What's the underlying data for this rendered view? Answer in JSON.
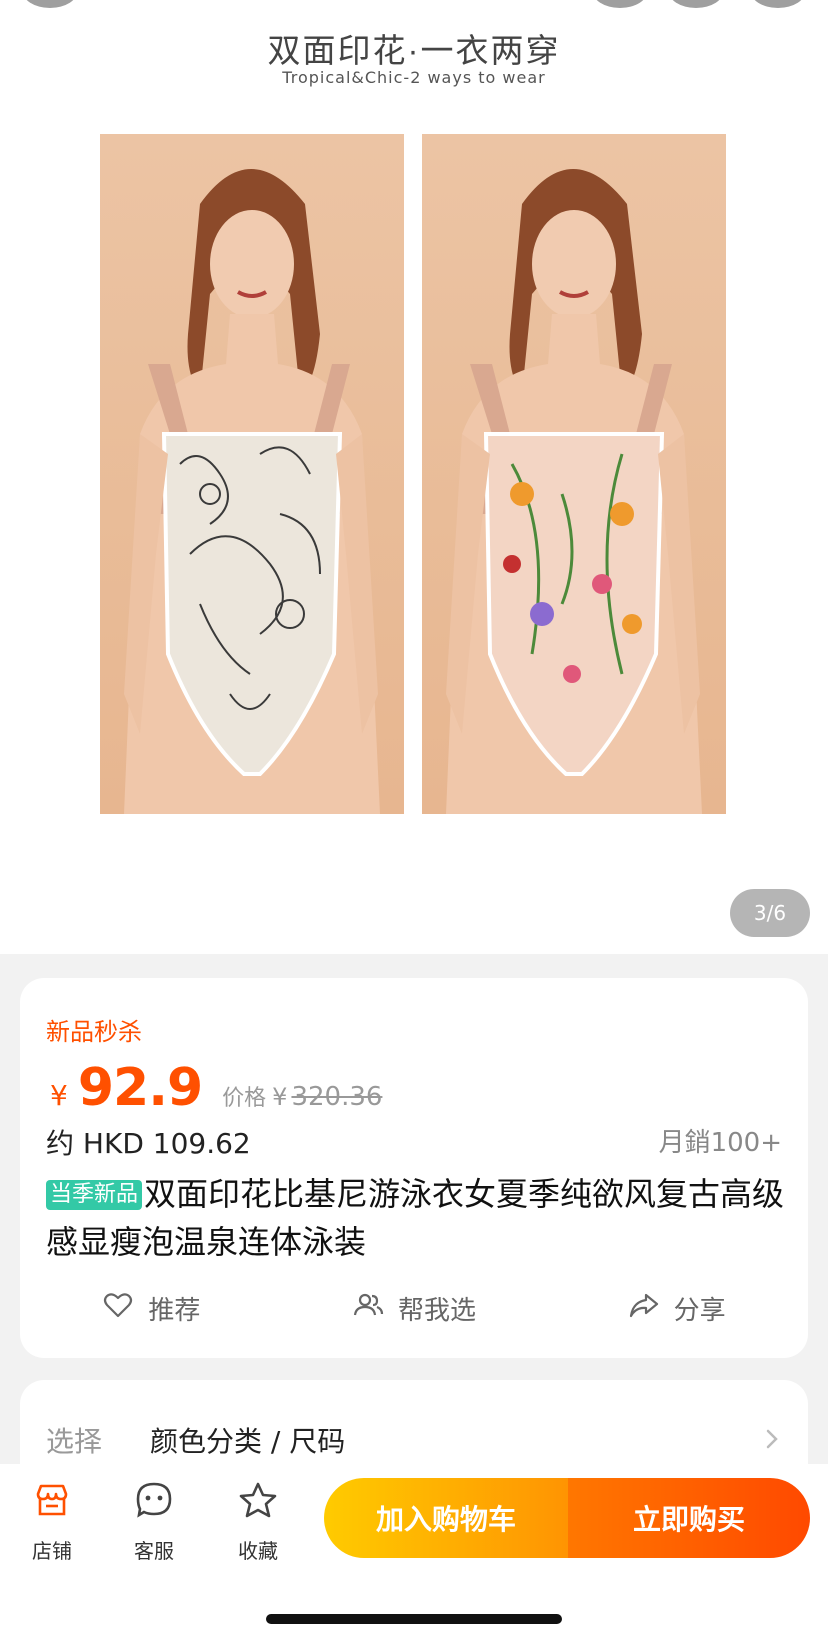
{
  "hero": {
    "heading": "双面印花·一衣两穿",
    "subheading": "Tropical&Chic-2 ways to wear",
    "page_indicator": "3/6",
    "current_image": 3,
    "total_images": 6
  },
  "info": {
    "flash_tag": "新品秒杀",
    "price_currency": "¥",
    "price": "92.9",
    "orig_label": "价格",
    "orig_currency": "¥",
    "orig_price": "320.36",
    "hkd_price": "约 HKD 109.62",
    "monthly_sales": "月銷100+",
    "new_badge": "当季新品",
    "title": "双面印花比基尼游泳衣女夏季纯欲风复古高级感显瘦泡温泉连体泳装",
    "actions": [
      {
        "label": "推荐",
        "icon": "heart-icon"
      },
      {
        "label": "帮我选",
        "icon": "people-icon"
      },
      {
        "label": "分享",
        "icon": "share-icon"
      }
    ]
  },
  "select": {
    "label": "选择",
    "value": "颜色分类 / 尺码"
  },
  "bottom_bar": {
    "tabs": [
      {
        "label": "店铺",
        "icon": "store-icon"
      },
      {
        "label": "客服",
        "icon": "chat-icon"
      },
      {
        "label": "收藏",
        "icon": "star-icon"
      }
    ],
    "cart_label": "加入购物车",
    "buy_label": "立即购买"
  },
  "colors": {
    "accent": "#ff5000",
    "badge": "#33c9a6",
    "store_icon": "#ff5000",
    "cart_gradient": [
      "#ffcb00",
      "#ff9402"
    ],
    "buy_gradient": [
      "#ff7700",
      "#ff4900"
    ]
  }
}
